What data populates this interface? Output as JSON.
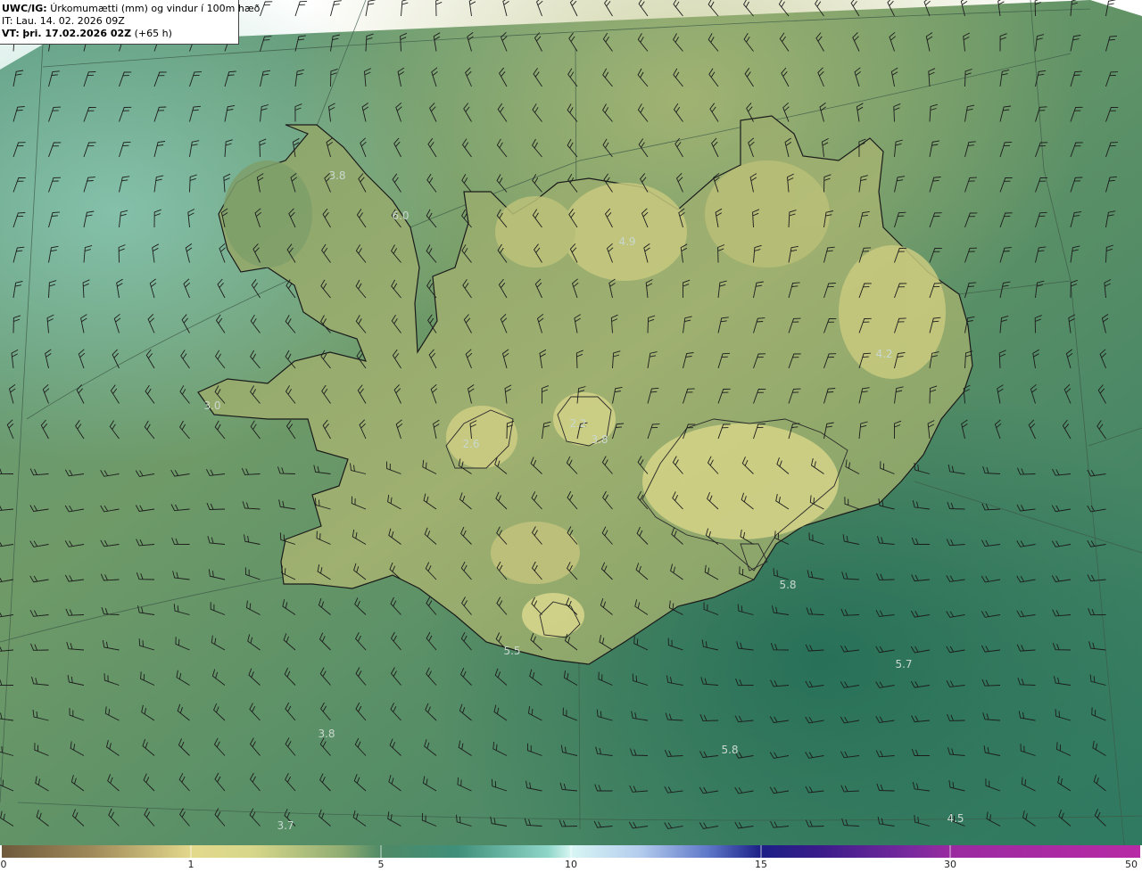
{
  "header": {
    "model": "UWC/IG:",
    "title": "Úrkomumætti (mm) og vindur í 100m hæð",
    "init": "IT: Lau. 14. 02. 2026 09Z",
    "valid_prefix": "VT:",
    "valid": "þri. 17.02.2026 02Z",
    "lead": "(+65 h)"
  },
  "map_values": [
    "3.8",
    "6.0",
    "4.9",
    "4.2",
    "3.0",
    "2.6",
    "2.2",
    "3.8",
    "5.8",
    "5.5",
    "5.7",
    "3.8",
    "5.8",
    "3.7",
    "4.5"
  ],
  "colorbar": {
    "ticks": [
      "0",
      "1",
      "5",
      "10",
      "15",
      "30",
      "50"
    ],
    "colors": [
      "#6e5a3c",
      "#c9b06a",
      "#e9e58e",
      "#bdc77a",
      "#7aa070",
      "#2d6e5a",
      "#6fbfae",
      "#c7f2f2",
      "#87a6dd",
      "#2a2a9a",
      "#3a107e",
      "#9a2aa0",
      "#b12aa4"
    ]
  },
  "colors": {
    "sea": "#2f7a62",
    "land_low": "#6f955f",
    "land_high": "#d7d889",
    "coast": "#1a1a1a",
    "barb": "#1c1c1c"
  }
}
